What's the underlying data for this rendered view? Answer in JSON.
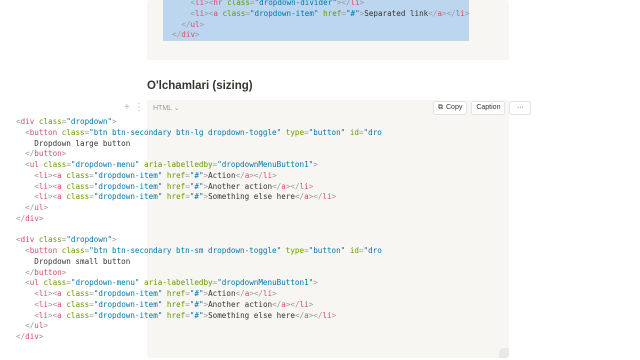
{
  "top_block": {
    "lines": [
      [
        [
          "punc",
          "      <"
        ],
        [
          "tag",
          "li"
        ],
        [
          "punc",
          "><"
        ],
        [
          "tag",
          "hr"
        ],
        [
          "punc",
          " "
        ],
        [
          "attr",
          "class"
        ],
        [
          "punc",
          "="
        ],
        [
          "str",
          "\"dropdown-divider\""
        ],
        [
          "punc",
          "></"
        ],
        [
          "tag",
          "li"
        ],
        [
          "punc",
          ">"
        ]
      ],
      [
        [
          "punc",
          "      <"
        ],
        [
          "tag",
          "li"
        ],
        [
          "punc",
          "><"
        ],
        [
          "tag",
          "a"
        ],
        [
          "punc",
          " "
        ],
        [
          "attr",
          "class"
        ],
        [
          "punc",
          "="
        ],
        [
          "str",
          "\"dropdown-item\""
        ],
        [
          "punc",
          " "
        ],
        [
          "attr",
          "href"
        ],
        [
          "punc",
          "="
        ],
        [
          "str",
          "\"#\""
        ],
        [
          "punc",
          ">"
        ],
        [
          "txt",
          "Separated link"
        ],
        [
          "punc",
          "</"
        ],
        [
          "tag",
          "a"
        ],
        [
          "punc",
          "></"
        ],
        [
          "tag",
          "li"
        ],
        [
          "punc",
          ">"
        ]
      ],
      [
        [
          "punc",
          "    </"
        ],
        [
          "tag",
          "ul"
        ],
        [
          "punc",
          ">"
        ]
      ],
      [
        [
          "punc",
          "  </"
        ],
        [
          "tag",
          "div"
        ],
        [
          "punc",
          ">"
        ]
      ]
    ]
  },
  "section": {
    "heading": "O'lchamlari (sizing)"
  },
  "code_header": {
    "language": "HTML",
    "copy_label": "Copy",
    "caption_label": "Caption",
    "more_label": "···"
  },
  "main_block": {
    "lines": [
      [
        [
          "punc",
          "<"
        ],
        [
          "tag",
          "div"
        ],
        [
          "punc",
          " "
        ],
        [
          "attr",
          "class"
        ],
        [
          "punc",
          "="
        ],
        [
          "str",
          "\"dropdown\""
        ],
        [
          "punc",
          ">"
        ]
      ],
      [
        [
          "punc",
          "  <"
        ],
        [
          "tag",
          "button"
        ],
        [
          "punc",
          " "
        ],
        [
          "attr",
          "class"
        ],
        [
          "punc",
          "="
        ],
        [
          "str",
          "\"btn btn-secondary btn-lg dropdown-toggle\""
        ],
        [
          "punc",
          " "
        ],
        [
          "attr",
          "type"
        ],
        [
          "punc",
          "="
        ],
        [
          "str",
          "\"button\""
        ],
        [
          "punc",
          " "
        ],
        [
          "attr",
          "id"
        ],
        [
          "punc",
          "="
        ],
        [
          "str",
          "\"dro"
        ]
      ],
      [
        [
          "txt",
          "    Dropdown large button"
        ]
      ],
      [
        [
          "punc",
          "  </"
        ],
        [
          "tag",
          "button"
        ],
        [
          "punc",
          ">"
        ]
      ],
      [
        [
          "punc",
          "  <"
        ],
        [
          "tag",
          "ul"
        ],
        [
          "punc",
          " "
        ],
        [
          "attr",
          "class"
        ],
        [
          "punc",
          "="
        ],
        [
          "str",
          "\"dropdown-menu\""
        ],
        [
          "punc",
          " "
        ],
        [
          "attr",
          "aria-labelledby"
        ],
        [
          "punc",
          "="
        ],
        [
          "str",
          "\"dropdownMenuButton1\""
        ],
        [
          "punc",
          ">"
        ]
      ],
      [
        [
          "punc",
          "    <"
        ],
        [
          "tag",
          "li"
        ],
        [
          "punc",
          "><"
        ],
        [
          "tag",
          "a"
        ],
        [
          "punc",
          " "
        ],
        [
          "attr",
          "class"
        ],
        [
          "punc",
          "="
        ],
        [
          "str",
          "\"dropdown-item\""
        ],
        [
          "punc",
          " "
        ],
        [
          "attr",
          "href"
        ],
        [
          "punc",
          "="
        ],
        [
          "str",
          "\"#\""
        ],
        [
          "punc",
          ">"
        ],
        [
          "txt",
          "Action"
        ],
        [
          "punc",
          "</"
        ],
        [
          "tag",
          "a"
        ],
        [
          "punc",
          "></"
        ],
        [
          "tag",
          "li"
        ],
        [
          "punc",
          ">"
        ]
      ],
      [
        [
          "punc",
          "    <"
        ],
        [
          "tag",
          "li"
        ],
        [
          "punc",
          "><"
        ],
        [
          "tag",
          "a"
        ],
        [
          "punc",
          " "
        ],
        [
          "attr",
          "class"
        ],
        [
          "punc",
          "="
        ],
        [
          "str",
          "\"dropdown-item\""
        ],
        [
          "punc",
          " "
        ],
        [
          "attr",
          "href"
        ],
        [
          "punc",
          "="
        ],
        [
          "str",
          "\"#\""
        ],
        [
          "punc",
          ">"
        ],
        [
          "txt",
          "Another action"
        ],
        [
          "punc",
          "</"
        ],
        [
          "tag",
          "a"
        ],
        [
          "punc",
          "></"
        ],
        [
          "tag",
          "li"
        ],
        [
          "punc",
          ">"
        ]
      ],
      [
        [
          "punc",
          "    <"
        ],
        [
          "tag",
          "li"
        ],
        [
          "punc",
          "><"
        ],
        [
          "tag",
          "a"
        ],
        [
          "punc",
          " "
        ],
        [
          "attr",
          "class"
        ],
        [
          "punc",
          "="
        ],
        [
          "str",
          "\"dropdown-item\""
        ],
        [
          "punc",
          " "
        ],
        [
          "attr",
          "href"
        ],
        [
          "punc",
          "="
        ],
        [
          "str",
          "\"#\""
        ],
        [
          "punc",
          ">"
        ],
        [
          "txt",
          "Something else here"
        ],
        [
          "punc",
          "</"
        ],
        [
          "tag",
          "a"
        ],
        [
          "punc",
          "></"
        ],
        [
          "tag",
          "li"
        ],
        [
          "punc",
          ">"
        ]
      ],
      [
        [
          "punc",
          "  </"
        ],
        [
          "tag",
          "ul"
        ],
        [
          "punc",
          ">"
        ]
      ],
      [
        [
          "punc",
          "</"
        ],
        [
          "tag",
          "div"
        ],
        [
          "punc",
          ">"
        ]
      ],
      [
        [
          "txt",
          ""
        ]
      ],
      [
        [
          "punc",
          "<"
        ],
        [
          "tag",
          "div"
        ],
        [
          "punc",
          " "
        ],
        [
          "attr",
          "class"
        ],
        [
          "punc",
          "="
        ],
        [
          "str",
          "\"dropdown\""
        ],
        [
          "punc",
          ">"
        ]
      ],
      [
        [
          "punc",
          "  <"
        ],
        [
          "tag",
          "button"
        ],
        [
          "punc",
          " "
        ],
        [
          "attr",
          "class"
        ],
        [
          "punc",
          "="
        ],
        [
          "str",
          "\"btn btn-secondary btn-sm dropdown-toggle\""
        ],
        [
          "punc",
          " "
        ],
        [
          "attr",
          "type"
        ],
        [
          "punc",
          "="
        ],
        [
          "str",
          "\"button\""
        ],
        [
          "punc",
          " "
        ],
        [
          "attr",
          "id"
        ],
        [
          "punc",
          "="
        ],
        [
          "str",
          "\"dro"
        ]
      ],
      [
        [
          "txt",
          "    Dropdown small button"
        ]
      ],
      [
        [
          "punc",
          "  </"
        ],
        [
          "tag",
          "button"
        ],
        [
          "punc",
          ">"
        ]
      ],
      [
        [
          "punc",
          "  <"
        ],
        [
          "tag",
          "ul"
        ],
        [
          "punc",
          " "
        ],
        [
          "attr",
          "class"
        ],
        [
          "punc",
          "="
        ],
        [
          "str",
          "\"dropdown-menu\""
        ],
        [
          "punc",
          " "
        ],
        [
          "attr",
          "aria-labelledby"
        ],
        [
          "punc",
          "="
        ],
        [
          "str",
          "\"dropdownMenuButton1\""
        ],
        [
          "punc",
          ">"
        ]
      ],
      [
        [
          "punc",
          "    <"
        ],
        [
          "tag",
          "li"
        ],
        [
          "punc",
          "><"
        ],
        [
          "tag",
          "a"
        ],
        [
          "punc",
          " "
        ],
        [
          "attr",
          "class"
        ],
        [
          "punc",
          "="
        ],
        [
          "str",
          "\"dropdown-item\""
        ],
        [
          "punc",
          " "
        ],
        [
          "attr",
          "href"
        ],
        [
          "punc",
          "="
        ],
        [
          "str",
          "\"#\""
        ],
        [
          "punc",
          ">"
        ],
        [
          "txt",
          "Action"
        ],
        [
          "punc",
          "</"
        ],
        [
          "tag",
          "a"
        ],
        [
          "punc",
          "></"
        ],
        [
          "tag",
          "li"
        ],
        [
          "punc",
          ">"
        ]
      ],
      [
        [
          "punc",
          "    <"
        ],
        [
          "tag",
          "li"
        ],
        [
          "punc",
          "><"
        ],
        [
          "tag",
          "a"
        ],
        [
          "punc",
          " "
        ],
        [
          "attr",
          "class"
        ],
        [
          "punc",
          "="
        ],
        [
          "str",
          "\"dropdown-item\""
        ],
        [
          "punc",
          " "
        ],
        [
          "attr",
          "href"
        ],
        [
          "punc",
          "="
        ],
        [
          "str",
          "\"#\""
        ],
        [
          "punc",
          ">"
        ],
        [
          "txt",
          "Another action"
        ],
        [
          "punc",
          "</"
        ],
        [
          "tag",
          "a"
        ],
        [
          "punc",
          "></"
        ],
        [
          "tag",
          "li"
        ],
        [
          "punc",
          ">"
        ]
      ],
      [
        [
          "punc",
          "    <"
        ],
        [
          "tag",
          "li"
        ],
        [
          "punc",
          "><"
        ],
        [
          "tag",
          "a"
        ],
        [
          "punc",
          " "
        ],
        [
          "attr",
          "class"
        ],
        [
          "punc",
          "="
        ],
        [
          "str",
          "\"dropdown-item\""
        ],
        [
          "punc",
          " "
        ],
        [
          "attr",
          "href"
        ],
        [
          "punc",
          "="
        ],
        [
          "str",
          "\"#\""
        ],
        [
          "punc",
          ">"
        ],
        [
          "txt",
          "Something else here"
        ],
        [
          "punc",
          "</"
        ],
        [
          "tag",
          "a"
        ],
        [
          "punc",
          "></"
        ],
        [
          "tag",
          "li"
        ],
        [
          "punc",
          ">"
        ]
      ],
      [
        [
          "punc",
          "  </"
        ],
        [
          "tag",
          "ul"
        ],
        [
          "punc",
          ">"
        ]
      ],
      [
        [
          "punc",
          "</"
        ],
        [
          "tag",
          "div"
        ],
        [
          "punc",
          ">"
        ]
      ]
    ]
  },
  "icons": {
    "add": "plus-icon",
    "drag": "drag-handle-icon",
    "copy": "copy-icon",
    "chevron": "chevron-down-icon"
  },
  "colors": {
    "code_bg": "#f7f6f3",
    "selection": "#bcd6f0",
    "tag": "#dd4a68",
    "attr": "#669900",
    "string": "#0077aa"
  }
}
